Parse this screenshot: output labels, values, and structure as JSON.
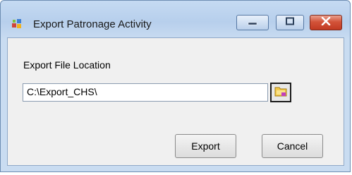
{
  "window": {
    "title": "Export Patronage Activity"
  },
  "form": {
    "location_label": "Export File Location",
    "location_value": "C:\\Export_CHS\\"
  },
  "buttons": {
    "export": "Export",
    "cancel": "Cancel"
  },
  "icons": {
    "app": "app-icon",
    "browse": "folder-icon",
    "minimize": "minimize-icon",
    "maximize": "maximize-icon",
    "close": "close-icon"
  },
  "colors": {
    "close_button": "#c94a2f",
    "titlebar": "#b9d1ee"
  }
}
